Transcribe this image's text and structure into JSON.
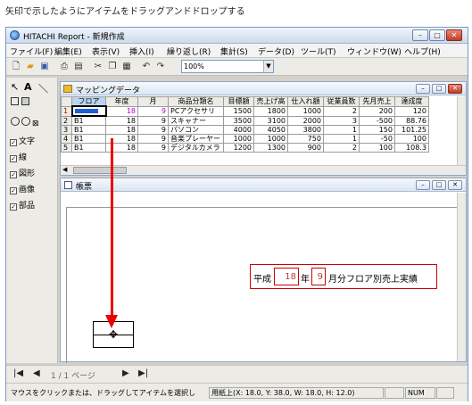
{
  "caption": "矢印で示したようにアイテムをドラッグアンドドロップする",
  "window": {
    "title": "HITACHI Report - 新規作成",
    "minimize": "–",
    "maximize": "□",
    "close": "✕"
  },
  "menu": [
    "ファイル(F)",
    "編集(E)",
    "表示(V)",
    "挿入(I)",
    "繰り返し(R)",
    "集計(S)",
    "データ(D)",
    "ツール(T)",
    "ウィンドウ(W)",
    "ヘルプ(H)"
  ],
  "toolbar": {
    "zoom": "100%",
    "icons": [
      "new-icon",
      "open-icon",
      "save-icon",
      "print-icon",
      "preview-icon",
      "cut-icon",
      "copy-icon",
      "paste-icon",
      "undo-icon",
      "redo-icon"
    ]
  },
  "tools": {
    "select": "↖",
    "text_tool": "A",
    "line_tool": "＼",
    "items": [
      {
        "label": "文字",
        "checked": true
      },
      {
        "label": "線",
        "checked": true
      },
      {
        "label": "図形",
        "checked": true
      },
      {
        "label": "画像",
        "checked": true
      },
      {
        "label": "部品",
        "checked": true
      }
    ]
  },
  "mapping": {
    "title": "マッピングデータ",
    "columns": [
      "フロア",
      "年度",
      "月",
      "商品分類名",
      "目標額",
      "売上げ高",
      "仕入れ額",
      "従業員数",
      "先月売上",
      "達成度"
    ],
    "rows": [
      [
        "1",
        "",
        "18",
        "9",
        "PCアクセサリ",
        "1500",
        "1800",
        "1000",
        "2",
        "200",
        "120"
      ],
      [
        "2",
        "B1",
        "18",
        "9",
        "スキャナー",
        "3500",
        "3100",
        "2000",
        "3",
        "-500",
        "88.76"
      ],
      [
        "3",
        "B1",
        "18",
        "9",
        "パソコン",
        "4000",
        "4050",
        "3800",
        "1",
        "150",
        "101.25"
      ],
      [
        "4",
        "B1",
        "18",
        "9",
        "音楽プレーヤー",
        "1000",
        "1000",
        "750",
        "1",
        "-50",
        "100"
      ],
      [
        "5",
        "B1",
        "18",
        "9",
        "デジタルカメラ",
        "1200",
        "1300",
        "900",
        "2",
        "100",
        "108.3"
      ]
    ]
  },
  "report": {
    "title": "帳票",
    "heading": {
      "era": "平成",
      "year": "18",
      "year_suffix": "年",
      "month": "9",
      "rest": "月分フロア別売上実績"
    }
  },
  "pager": {
    "first": "|◀",
    "prev": "◀",
    "page": "1 / 1 ページ",
    "next": "▶",
    "last": "▶|"
  },
  "status": {
    "message": "マウスをクリックまたは、ドラッグしてアイテムを選択し",
    "position": "用紙上(X: 18.0, Y: 38.0, W: 18.0, H: 12.0)",
    "num": "NUM"
  }
}
